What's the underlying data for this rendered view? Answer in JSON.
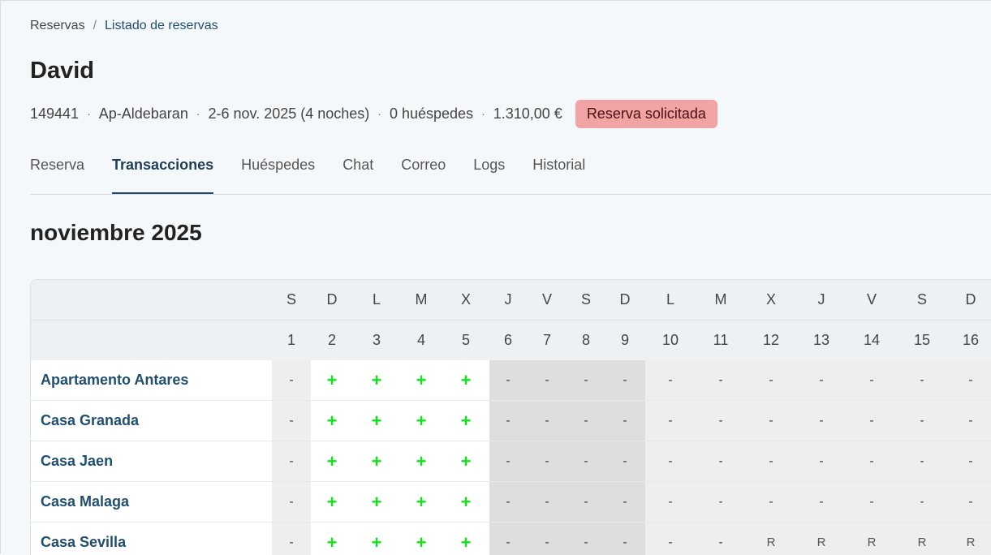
{
  "breadcrumb": {
    "root": "Reservas",
    "separator": "/",
    "current": "Listado de reservas"
  },
  "guest_name": "David",
  "booking": {
    "id": "149441",
    "property": "Ap-Aldebaran",
    "dates": "2-6 nov. 2025 (4 noches)",
    "guests": "0 huéspedes",
    "total": "1.310,00 €",
    "dot": "·",
    "status": "Reserva solicitada",
    "status_color": "#f2a3a3"
  },
  "tabs": [
    {
      "label": "Reserva"
    },
    {
      "label": "Transacciones",
      "active": true
    },
    {
      "label": "Huéspedes"
    },
    {
      "label": "Chat"
    },
    {
      "label": "Correo"
    },
    {
      "label": "Logs"
    },
    {
      "label": "Historial"
    }
  ],
  "calendar": {
    "month": "noviembre 2025",
    "weekdays": [
      "S",
      "D",
      "L",
      "M",
      "X",
      "J",
      "V",
      "S",
      "D",
      "L",
      "M",
      "X",
      "J",
      "V",
      "S",
      "D"
    ],
    "days": [
      "1",
      "2",
      "3",
      "4",
      "5",
      "6",
      "7",
      "8",
      "9",
      "10",
      "11",
      "12",
      "13",
      "14",
      "15",
      "16"
    ],
    "rows": [
      {
        "name": "Apartamento Antares",
        "cells": [
          "-",
          "+",
          "+",
          "+",
          "+",
          "-",
          "-",
          "-",
          "-",
          "-",
          "-",
          "-",
          "-",
          "-",
          "-",
          "-"
        ]
      },
      {
        "name": "Casa Granada",
        "cells": [
          "-",
          "+",
          "+",
          "+",
          "+",
          "-",
          "-",
          "-",
          "-",
          "-",
          "-",
          "-",
          "-",
          "-",
          "-",
          "-"
        ]
      },
      {
        "name": "Casa Jaen",
        "cells": [
          "-",
          "+",
          "+",
          "+",
          "+",
          "-",
          "-",
          "-",
          "-",
          "-",
          "-",
          "-",
          "-",
          "-",
          "-",
          "-"
        ]
      },
      {
        "name": "Casa Malaga",
        "cells": [
          "-",
          "+",
          "+",
          "+",
          "+",
          "-",
          "-",
          "-",
          "-",
          "-",
          "-",
          "-",
          "-",
          "-",
          "-",
          "-"
        ]
      },
      {
        "name": "Casa Sevilla",
        "cells": [
          "-",
          "+",
          "+",
          "+",
          "+",
          "-",
          "-",
          "-",
          "-",
          "-",
          "-",
          "R",
          "R",
          "R",
          "R",
          "R"
        ]
      }
    ],
    "colors": {
      "available": "#12e21b",
      "weekend_shade": "#dedede",
      "other_shade": "#eeeeee"
    }
  }
}
